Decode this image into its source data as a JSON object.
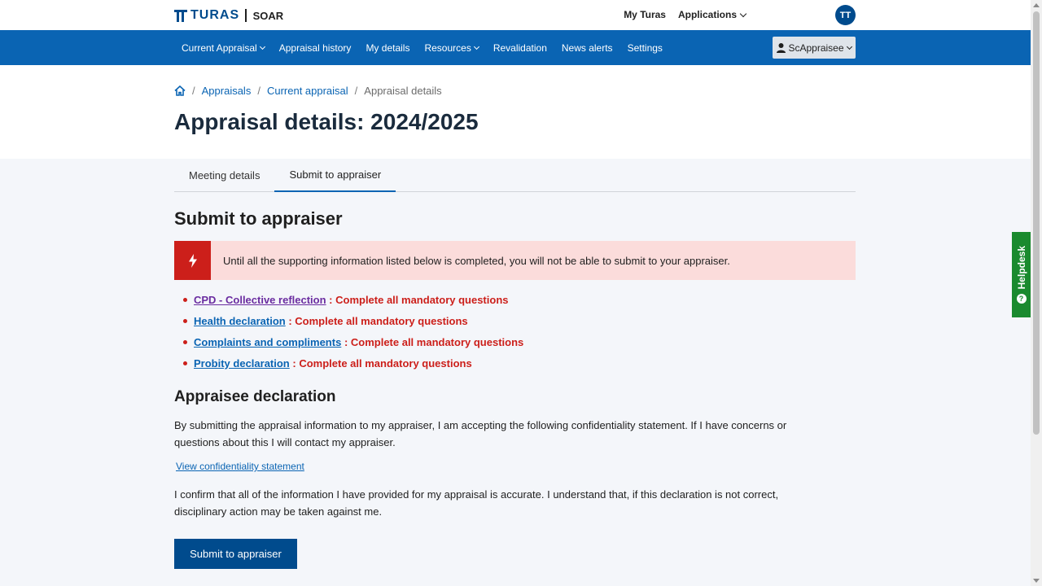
{
  "brand": {
    "logo_text": "TURAS",
    "app_name": "SOAR"
  },
  "top_links": [
    {
      "label": "My Turas",
      "dropdown": false
    },
    {
      "label": "Applications",
      "dropdown": true
    }
  ],
  "user": {
    "initials": "TT",
    "menu_label": "ScAppraisee"
  },
  "nav": {
    "items": [
      {
        "label": "Current Appraisal",
        "dropdown": true
      },
      {
        "label": "Appraisal history",
        "dropdown": false
      },
      {
        "label": "My details",
        "dropdown": false
      },
      {
        "label": "Resources",
        "dropdown": true
      },
      {
        "label": "Revalidation",
        "dropdown": false
      },
      {
        "label": "News alerts",
        "dropdown": false
      },
      {
        "label": "Settings",
        "dropdown": false
      }
    ]
  },
  "breadcrumb": {
    "home_icon": "home-icon",
    "items": [
      "Appraisals",
      "Current appraisal"
    ],
    "current": "Appraisal details"
  },
  "page": {
    "title": "Appraisal details: 2024/2025"
  },
  "tabs": [
    {
      "label": "Meeting details",
      "active": false
    },
    {
      "label": "Submit to appraiser",
      "active": true
    }
  ],
  "section": {
    "title": "Submit to appraiser"
  },
  "alert": {
    "icon": "lightning-icon",
    "text": "Until all the supporting information listed below is completed, you will not be able to submit to your appraiser."
  },
  "issues": [
    {
      "link": "CPD - Collective reflection",
      "message": ": Complete all mandatory questions",
      "visited": true
    },
    {
      "link": "Health declaration",
      "message": ": Complete all mandatory questions",
      "visited": false
    },
    {
      "link": "Complaints and compliments",
      "message": ": Complete all mandatory questions",
      "visited": false
    },
    {
      "link": "Probity declaration",
      "message": ": Complete all mandatory questions",
      "visited": false
    }
  ],
  "declaration": {
    "title": "Appraisee declaration",
    "para1": "By submitting the appraisal information to my appraiser, I am accepting the following confidentiality statement. If I have concerns or questions about this I will contact my appraiser.",
    "link": "View confidentiality statement",
    "para2": "I confirm that all of the information I have provided for my appraisal is accurate. I understand that, if this declaration is not correct, disciplinary action may be taken against me."
  },
  "submit_button": "Submit to appraiser",
  "helpdesk": {
    "label": "Helpdesk",
    "icon": "question-icon",
    "icon_glyph": "?"
  },
  "colors": {
    "brand": "#004b8d",
    "nav": "#0a64b3",
    "danger": "#cc1f1a",
    "alert_bg": "#fbdcdb",
    "helpdesk": "#1a8a2e"
  }
}
